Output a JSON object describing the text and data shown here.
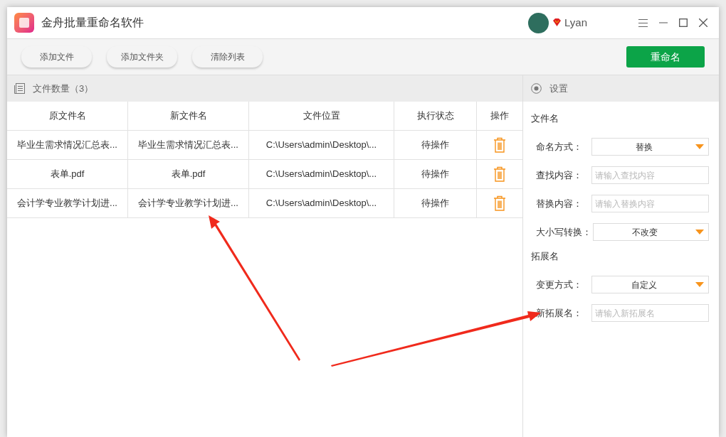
{
  "window": {
    "title": "金舟批量重命名软件"
  },
  "user": {
    "name": "Lyan"
  },
  "toolbar": {
    "buttons": [
      "添加文件",
      "添加文件夹",
      "清除列表"
    ],
    "primary_button": "重命名"
  },
  "file_list": {
    "title": "文件数量（3）",
    "columns": [
      "原文件名",
      "新文件名",
      "文件位置",
      "执行状态",
      "操作"
    ],
    "rows": [
      {
        "original": "毕业生需求情况汇总表...",
        "new": "毕业生需求情况汇总表...",
        "location": "C:\\Users\\admin\\Desktop\\...",
        "status": "待操作"
      },
      {
        "original": "表单.pdf",
        "new": "表单.pdf",
        "location": "C:\\Users\\admin\\Desktop\\...",
        "status": "待操作"
      },
      {
        "original": "会计学专业教学计划进...",
        "new": "会计学专业教学计划进...",
        "location": "C:\\Users\\admin\\Desktop\\...",
        "status": "待操作"
      }
    ]
  },
  "settings": {
    "title": "设置",
    "sections": [
      {
        "title": "文件名",
        "fields": [
          {
            "kind": "select",
            "label": "命名方式：",
            "value": "替换"
          },
          {
            "kind": "input",
            "label": "查找内容：",
            "placeholder": "请输入查找内容"
          },
          {
            "kind": "input",
            "label": "替换内容：",
            "placeholder": "请输入替换内容"
          },
          {
            "kind": "select",
            "label": "大小写转换：",
            "value": "不改变"
          }
        ]
      },
      {
        "title": "拓展名",
        "fields": [
          {
            "kind": "select",
            "label": "变更方式：",
            "value": "自定义"
          },
          {
            "kind": "input",
            "label": "新拓展名：",
            "placeholder": "请输入新拓展名"
          }
        ]
      }
    ]
  }
}
